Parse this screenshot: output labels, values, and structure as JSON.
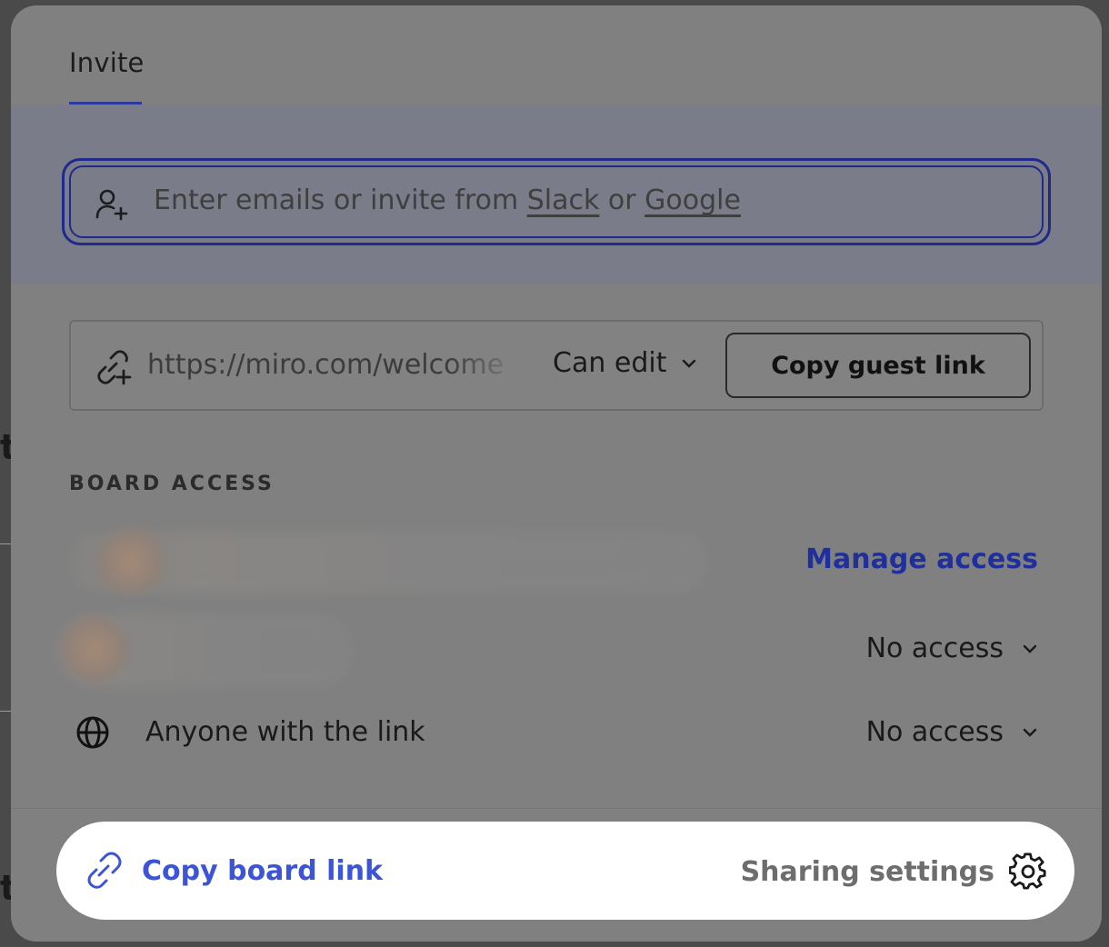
{
  "tabs": [
    {
      "label": "Invite",
      "active": true
    }
  ],
  "invite": {
    "placeholder_prefix": "Enter emails or invite from ",
    "slack": "Slack",
    "or": " or ",
    "google": "Google"
  },
  "guest_link": {
    "url": "https://miro.com/welcome",
    "permission": "Can edit",
    "copy_label": "Copy guest link"
  },
  "board_access": {
    "section_label": "BOARD ACCESS",
    "manage_label": "Manage access",
    "rows": [
      {
        "permission": "No access"
      },
      {
        "label": "Anyone with the link",
        "permission": "No access"
      }
    ]
  },
  "footer": {
    "copy_board_label": "Copy board link",
    "sharing_settings_label": "Sharing settings"
  },
  "colors": {
    "accent": "#3b55d6",
    "focus_border": "#1f2a8a",
    "overlay": "#808080"
  }
}
